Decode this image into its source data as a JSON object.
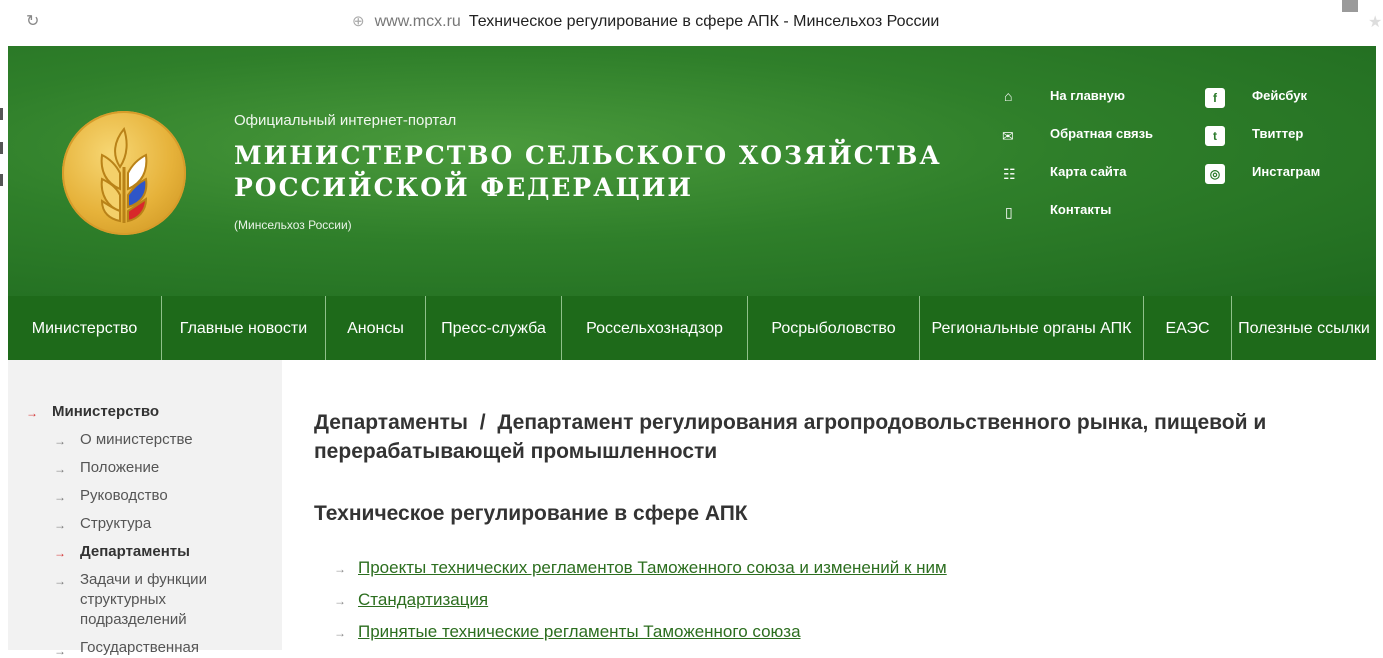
{
  "browser": {
    "reload_icon": "reload-icon",
    "domain": "www.mcx.ru",
    "page_title": "Техническое регулирование в сфере АПК - Минсельхоз России"
  },
  "header": {
    "subtitle": "Официальный интернет-портал",
    "title_line1": "МИНИСТЕРСТВО СЕЛЬСКОГО ХОЗЯЙСТВА",
    "title_line2": "РОССИЙСКОЙ ФЕДЕРАЦИИ",
    "abbr": "(Минсельхоз России)",
    "links": [
      {
        "label": "На главную",
        "icon": "home-icon"
      },
      {
        "label": "Обратная связь",
        "icon": "mail-icon"
      },
      {
        "label": "Карта сайта",
        "icon": "sitemap-icon"
      },
      {
        "label": "Контакты",
        "icon": "phone-icon"
      }
    ],
    "social": [
      {
        "label": "Фейсбук",
        "icon": "facebook-icon"
      },
      {
        "label": "Твиттер",
        "icon": "twitter-icon"
      },
      {
        "label": "Инстаграм",
        "icon": "instagram-icon"
      }
    ]
  },
  "nav": [
    {
      "label": "Министерство"
    },
    {
      "label": "Главные новости"
    },
    {
      "label": "Анонсы"
    },
    {
      "label": "Пресс-служба"
    },
    {
      "label": "Россельхознадзор"
    },
    {
      "label": "Росрыболовство"
    },
    {
      "label": "Региональные органы АПК"
    },
    {
      "label": "ЕАЭС"
    },
    {
      "label": "Полезные ссылки"
    }
  ],
  "sidebar": {
    "top": "Министерство",
    "items": [
      "О министерстве",
      "Положение",
      "Руководство",
      "Структура",
      "Департаменты",
      "Задачи и функции структурных подразделений",
      "Государственная"
    ]
  },
  "main": {
    "breadcrumb_part1": "Департаменты",
    "breadcrumb_sep": "/",
    "breadcrumb_part2": "Департамент регулирования агропродовольственного рынка, пищевой и перерабатывающей промышленности",
    "section_title": "Техническое регулирование в сфере АПК",
    "links": [
      "Проекты технических регламентов Таможенного союза и изменений к ним",
      "Стандартизация",
      "Принятые технические регламенты Таможенного союза"
    ]
  },
  "colors": {
    "header_green": "#2f7f2a",
    "nav_green": "#1e6a1a",
    "link_green": "#2c6e1f",
    "arrow_red": "#d32f2f"
  }
}
